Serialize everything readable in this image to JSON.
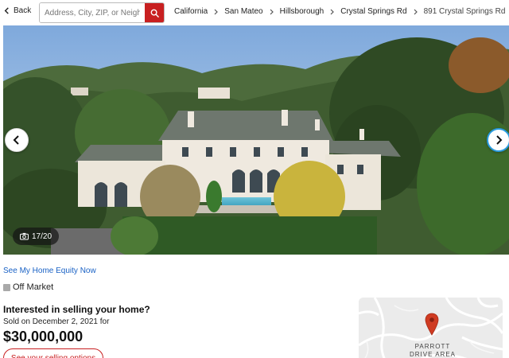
{
  "nav": {
    "back_label": "Back",
    "search_placeholder": "Address, City, ZIP, or Neighb",
    "breadcrumbs": [
      "California",
      "San Mateo",
      "Hillsborough",
      "Crystal Springs Rd",
      "891 Crystal Springs Rd"
    ]
  },
  "gallery": {
    "counter": "17/20",
    "icons": [
      "chevron-left-icon",
      "chevron-right-icon",
      "camera-icon"
    ]
  },
  "listing": {
    "equity_link": "See My Home Equity Now",
    "status": "Off Market",
    "interest_heading": "Interested in selling your home?",
    "sold_text": "Sold on December 2, 2021 for",
    "price": "$30,000,000",
    "selling_options_button": "See your selling options"
  },
  "map": {
    "area_label": "PARROTT DRIVE AREA"
  },
  "colors": {
    "brand_red": "#c82021",
    "link_blue": "#1a62c5",
    "status_gray": "#a9a9a9",
    "focus_blue": "#2a9be0"
  }
}
